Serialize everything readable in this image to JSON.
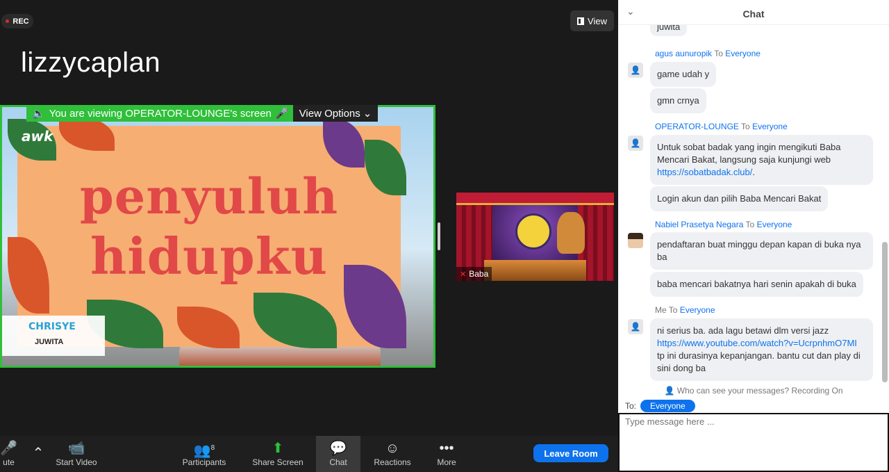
{
  "stage": {
    "rec_label": "REC",
    "view_label": "View",
    "speaker_name": "lizzycaplan"
  },
  "share": {
    "viewing_text": "You are viewing OPERATOR-LOUNGE's screen",
    "view_options_label": "View Options",
    "slide": {
      "logo_text": "awk",
      "title_line1": "penyuluh",
      "title_line2": "hidupku",
      "nametag_first": "CHRISYE",
      "nametag_last": "JUWITA"
    }
  },
  "thumbnail": {
    "participant_name": "Baba"
  },
  "toolbar": {
    "mute_label": "ute",
    "start_video_label": "Start Video",
    "participants_label": "Participants",
    "participants_count": "8",
    "share_screen_label": "Share Screen",
    "chat_label": "Chat",
    "reactions_label": "Reactions",
    "more_label": "More",
    "leave_label": "Leave Room"
  },
  "chat": {
    "title": "Chat",
    "top_partial": "juwita",
    "to_word": "To",
    "messages": [
      {
        "sender": "agus aunuropik",
        "target": "Everyone",
        "bubbles": [
          "game udah y",
          "gmn crnya"
        ]
      },
      {
        "sender": "OPERATOR-LOUNGE",
        "target": "Everyone",
        "bubble1_line1": "Untuk sobat badak yang ingin mengikuti Baba",
        "bubble1_line2": "Mencari Bakat, langsung saja kunjungi web",
        "bubble1_link": "https://sobatbadak.club/",
        "bubble1_end": ".",
        "bubble2": "Login akun dan pilih Baba Mencari Bakat"
      },
      {
        "sender": "Nabiel Prasetya Negara",
        "target": "Everyone",
        "bubble1_line1": "pendaftaran buat minggu depan kapan di buka nya",
        "bubble1_line2": "ba",
        "bubble2": "baba mencari bakatnya hari senin apakah di buka"
      },
      {
        "sender": "Me",
        "target": "Everyone",
        "line1": "ni serius ba. ada lagu betawi dlm versi jazz",
        "link": "https://www.youtube.com/watch?v=UcrpnhmO7MI",
        "line3": "tp ini durasinya kepanjangan. bantu cut dan play di",
        "line4": "sini dong ba"
      }
    ],
    "privacy_text": "Who can see your messages? Recording On",
    "to_label": "To:",
    "to_value": "Everyone",
    "input_placeholder": "Type message here ..."
  },
  "colors": {
    "accent_blue": "#0e72ed",
    "share_green": "#2fbf3a",
    "slide_orange": "#f7ae72",
    "slide_red": "#e14848"
  }
}
